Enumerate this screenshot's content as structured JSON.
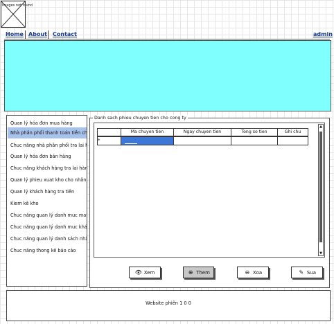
{
  "logo": {
    "caption": "Images not found"
  },
  "nav": {
    "home": "Home",
    "about": "About",
    "contact": "Contact",
    "user": "admin"
  },
  "sidebar": {
    "items": [
      {
        "label": "Quan lý hóa đơn mua hàng"
      },
      {
        "label": "Nhà phân phối thanh toán tiền cho cô"
      },
      {
        "label": "Chuc năng nhà phân phối tra lai hàng"
      },
      {
        "label": "Quan lý hóa đơn bán hàng"
      },
      {
        "label": "Chuc năng khách hàng tra lai hàng c"
      },
      {
        "label": "Quan lý phieu xuat kho cho nhân viê"
      },
      {
        "label": "Quan lý khách hàng tra tiên"
      },
      {
        "label": "Kiem kê kho"
      },
      {
        "label": "Chuc năng quan lý danh muc mat hà"
      },
      {
        "label": "Chuc năng quan lý danh muc khách h"
      },
      {
        "label": "Chuc năng quan lý danh sách nhân vi"
      },
      {
        "label": "Chuc năng thong kê báo cáo"
      }
    ],
    "active_index": 1
  },
  "content": {
    "group_title": "Danh sach phieu chuyen tien cho cong ty",
    "columns": [
      "Ma chuyen tien",
      "Ngay chuyen tien",
      "Tong so tien",
      "Ghi chu"
    ],
    "new_row_marker": "*",
    "buttons": {
      "view": "Xem",
      "add": "Them",
      "delete": "Xoa",
      "edit": "Sua"
    }
  },
  "footer": {
    "text": "Website phiên 1 0 0"
  },
  "colors": {
    "banner": "#80ffff",
    "active_item": "#a7c2eb",
    "selected_cell": "#3d78d8",
    "link": "#1a3a8a"
  },
  "icons": {
    "view": "eye-icon",
    "add": "plus-circle-icon",
    "delete": "minus-circle-icon",
    "edit": "pencil-icon"
  }
}
